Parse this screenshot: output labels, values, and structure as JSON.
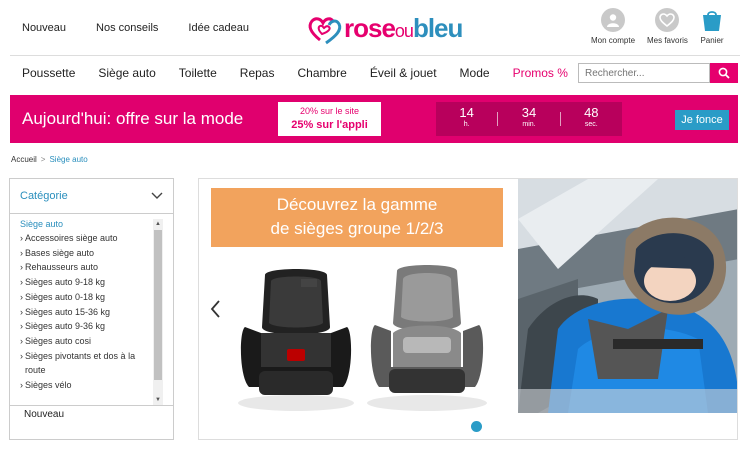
{
  "header": {
    "top_links": [
      "Nouveau",
      "Nos conseils",
      "Idée cadeau"
    ],
    "logo": {
      "part1": "rose",
      "part2": "ou",
      "part3": "bleu"
    },
    "account_label": "Mon compte",
    "favorites_label": "Mes favoris",
    "cart_label": "Panier"
  },
  "nav": {
    "items": [
      "Poussette",
      "Siège auto",
      "Toilette",
      "Repas",
      "Chambre",
      "Éveil & jouet",
      "Mode",
      "Promos %"
    ],
    "search_placeholder": "Rechercher..."
  },
  "band": {
    "title": "Aujourd'hui: offre sur la mode",
    "offer_line1": "20% sur le site",
    "offer_line2": "25% sur l'appli",
    "timer": [
      {
        "value": "14",
        "unit": "h."
      },
      {
        "value": "34",
        "unit": "min."
      },
      {
        "value": "48",
        "unit": "sec."
      }
    ],
    "button": "Je fonce"
  },
  "breadcrumb": {
    "home": "Accueil",
    "separator": ">",
    "current": "Siège auto"
  },
  "sidebar": {
    "heading": "Catégorie",
    "active_category": "Siège auto",
    "items": [
      "Accessoires siège auto",
      "Bases siège auto",
      "Rehausseurs auto",
      "Sièges auto 9-18 kg",
      "Sièges auto 0-18 kg",
      "Sièges auto 15-36 kg",
      "Sièges auto 9-36 kg",
      "Sièges auto cosi",
      "Sièges pivotants et dos à la route",
      "Sièges vélo"
    ],
    "next_section": "Nouveau"
  },
  "hero": {
    "tagline_line1": "Découvrez la gamme",
    "tagline_line2": "de sièges groupe 1/2/3"
  },
  "colors": {
    "brand_pink": "#e6006e",
    "brand_blue": "#2a9cc7",
    "promo_orange": "#f2a35d"
  }
}
